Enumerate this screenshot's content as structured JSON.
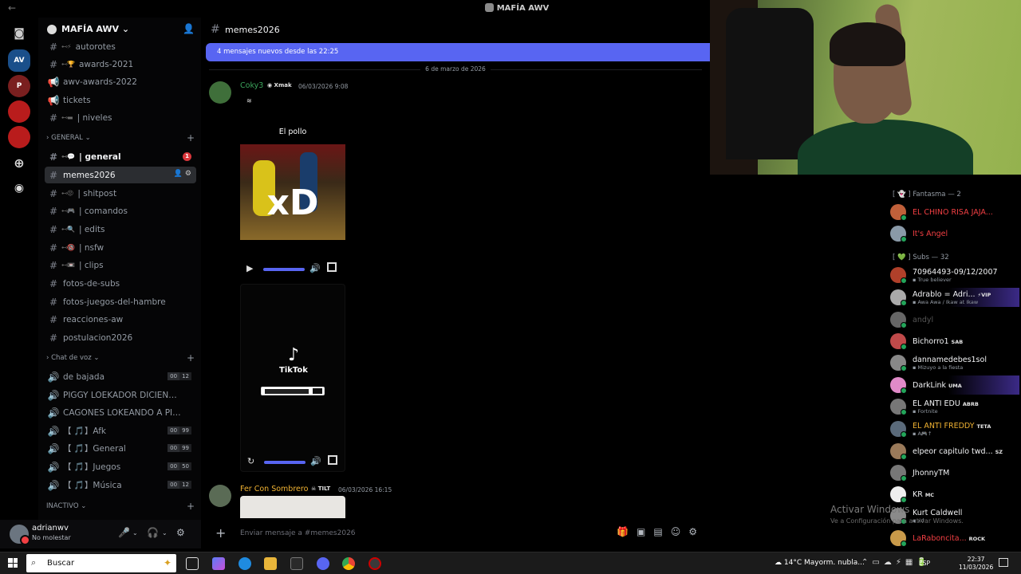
{
  "window": {
    "title": "MAFÍA AWV"
  },
  "server": {
    "name": "MAFÍA AWV"
  },
  "channels": [
    {
      "name": "autorotes",
      "kind": "text",
      "emoji": "⊷⚡",
      "state": "normal"
    },
    {
      "name": "awards-2021",
      "kind": "text",
      "emoji": "⊷🏆",
      "state": "normal"
    },
    {
      "name": "awv-awards-2022",
      "kind": "announce",
      "emoji": "",
      "state": "normal"
    },
    {
      "name": "tickets",
      "kind": "announce",
      "emoji": "",
      "state": "normal"
    },
    {
      "name": "| niveles",
      "kind": "text",
      "emoji": "⊷▬",
      "state": "normal"
    },
    {
      "name": "GENERAL",
      "kind": "category"
    },
    {
      "name": "| general",
      "kind": "text",
      "emoji": "⊷💬",
      "state": "unread",
      "badge": "1"
    },
    {
      "name": "memes2026",
      "kind": "text",
      "emoji": "",
      "state": "active"
    },
    {
      "name": "| shitpost",
      "kind": "text",
      "emoji": "⊷😡",
      "state": "normal"
    },
    {
      "name": "| comandos",
      "kind": "text",
      "emoji": "⊷🎮",
      "state": "normal"
    },
    {
      "name": "| edits",
      "kind": "text",
      "emoji": "⊷🔍",
      "state": "normal"
    },
    {
      "name": "| nsfw",
      "kind": "text",
      "emoji": "⊷🔞",
      "state": "normal"
    },
    {
      "name": "| clips",
      "kind": "text",
      "emoji": "⊷📼",
      "state": "normal"
    },
    {
      "name": "fotos-de-subs",
      "kind": "text",
      "emoji": "",
      "state": "normal"
    },
    {
      "name": "fotos-juegos-del-hambre",
      "kind": "text",
      "emoji": "",
      "state": "normal"
    },
    {
      "name": "reacciones-aw",
      "kind": "text",
      "emoji": "",
      "state": "normal"
    },
    {
      "name": "postulacion2026",
      "kind": "text",
      "emoji": "",
      "state": "normal"
    },
    {
      "name": "Chat de voz",
      "kind": "category"
    },
    {
      "name": "de bajada",
      "kind": "voice",
      "count": "00",
      "limit": "12"
    },
    {
      "name": "PIGGY LOEKADOR DICIENGO G...",
      "kind": "voice"
    },
    {
      "name": "CAGONES LOKEANDO A PIGGY ...",
      "kind": "voice"
    },
    {
      "name": "【 🎵】Afk",
      "kind": "voice",
      "count": "00",
      "limit": "99"
    },
    {
      "name": "【 🎵】General",
      "kind": "voice",
      "count": "00",
      "limit": "99"
    },
    {
      "name": "【 🎵】Juegos",
      "kind": "voice",
      "count": "00",
      "limit": "50"
    },
    {
      "name": "【 🎵】Música",
      "kind": "voice",
      "count": "00",
      "limit": "12"
    },
    {
      "name": "INACTIVO",
      "kind": "category"
    }
  ],
  "user": {
    "name": "adrianwv",
    "status": "No molestar"
  },
  "chat": {
    "channel": "memes2026",
    "new_messages": "4 mensajes nuevos desde las 22:25",
    "date_separator": "6 de marzo de 2026",
    "messages": [
      {
        "author": "Coky3",
        "tag": "Xmak",
        "time": "06/03/2026 9:08",
        "author_color": "#3ba55c",
        "video_caption": "El pollo",
        "video_text": "xD"
      },
      {
        "author": "",
        "video_brand": "TikTok"
      },
      {
        "author": "Fer Con Sombrero",
        "tag": "TILT",
        "time": "06/03/2026 16:15",
        "author_color": "#f0b232"
      }
    ],
    "composer_placeholder": "Enviar mensaje a #memes2026"
  },
  "members": {
    "groups": [
      {
        "label": "Fantasma — 2",
        "items": [
          {
            "name": "EL CHINO RISA JAJA...",
            "color": "#f23f43"
          },
          {
            "name": "It's Angel",
            "color": "#f23f43"
          }
        ]
      },
      {
        "label": "Subs — 32",
        "items": [
          {
            "name": "70964493-09/12/2007",
            "sub": "True believer",
            "color": "#f2f3f5"
          },
          {
            "name": "Adrablo = Adri...",
            "tag": "⚡VIP",
            "sub": "Awa Awa / Ikaw at Ikaw",
            "color": "#f2f3f5",
            "hl": true
          },
          {
            "name": "andyl",
            "color": "#555"
          },
          {
            "name": "Bichorro1",
            "tag": "SAB",
            "color": "#f2f3f5"
          },
          {
            "name": "dannamedebes1sol",
            "sub": "Mizuyo a la fiesta",
            "color": "#f2f3f5"
          },
          {
            "name": "DarkLink",
            "tag": "UMA",
            "color": "#f2f3f5",
            "hl": true
          },
          {
            "name": "EL ANTI EDU",
            "tag": "ABRB",
            "sub": "Fortnite",
            "color": "#f2f3f5"
          },
          {
            "name": "EL ANTI FREDDY",
            "tag": "TETA",
            "sub": "A🎮↑",
            "color": "#f0b232"
          },
          {
            "name": "elpeor capitulo twd...",
            "tag": "SZ",
            "color": "#f2f3f5"
          },
          {
            "name": "JhonnyTM",
            "color": "#f2f3f5"
          },
          {
            "name": "KR",
            "tag": "MC",
            "color": "#f2f3f5"
          },
          {
            "name": "Kurt Caldwell",
            "sub": "xd",
            "color": "#f2f3f5"
          },
          {
            "name": "LaRaboncita...",
            "tag": "ROCK",
            "color": "#f23f43"
          }
        ]
      }
    ]
  },
  "watermark": {
    "title": "Activar Windows",
    "subtitle": "Ve a Configuración para activar Windows."
  },
  "taskbar": {
    "search_label": "Buscar",
    "weather": "14°C  Mayorm. nubla...",
    "lang": "ESP",
    "time": "22:37",
    "date": "11/03/2026"
  }
}
